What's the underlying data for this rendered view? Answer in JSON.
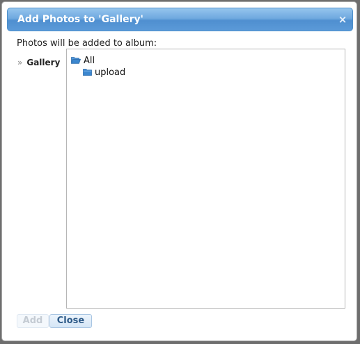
{
  "dialog": {
    "title": "Add Photos to 'Gallery'",
    "close_symbol": "×"
  },
  "info_text": "Photos will be added to album:",
  "album": {
    "marker": "»",
    "name": "Gallery"
  },
  "tree": {
    "root": {
      "label": "All",
      "icon": "folder-open-icon"
    },
    "children": [
      {
        "label": "upload",
        "icon": "folder-icon"
      }
    ]
  },
  "buttons": {
    "add_label": "Add",
    "close_label": "Close"
  },
  "colors": {
    "titlebar": "#5b9ad8",
    "folder": "#3c87cf",
    "button_text": "#2d5a88"
  }
}
